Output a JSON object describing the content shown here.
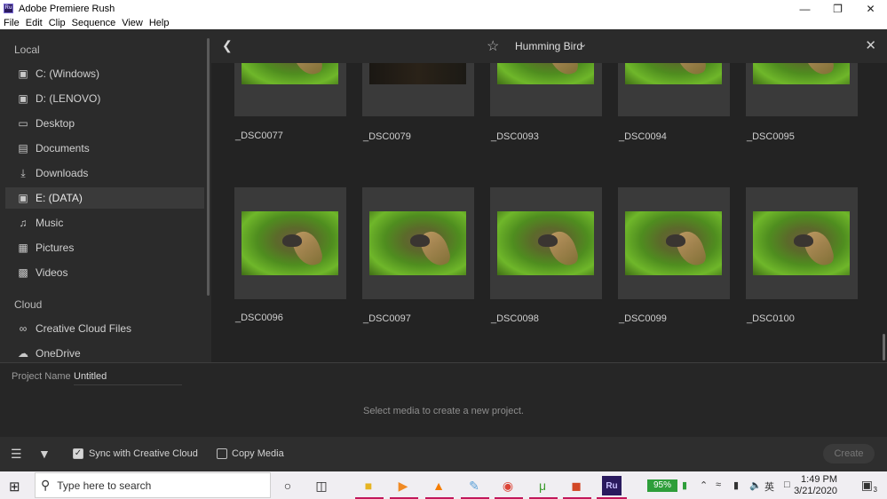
{
  "window": {
    "title": "Adobe Premiere Rush",
    "icon_text": "Ru"
  },
  "menu": [
    "File",
    "Edit",
    "Clip",
    "Sequence",
    "View",
    "Help"
  ],
  "sidebar": {
    "local_heading": "Local",
    "local_items": [
      {
        "label": "C: (Windows)",
        "icon": "monitor-icon"
      },
      {
        "label": "D: (LENOVO)",
        "icon": "monitor-icon"
      },
      {
        "label": "Desktop",
        "icon": "desktop-icon"
      },
      {
        "label": "Documents",
        "icon": "document-icon"
      },
      {
        "label": "Downloads",
        "icon": "download-icon"
      },
      {
        "label": "E: (DATA)",
        "icon": "monitor-icon",
        "selected": true
      },
      {
        "label": "Music",
        "icon": "music-icon"
      },
      {
        "label": "Pictures",
        "icon": "picture-icon"
      },
      {
        "label": "Videos",
        "icon": "video-icon"
      }
    ],
    "cloud_heading": "Cloud",
    "cloud_items": [
      {
        "label": "Creative Cloud Files",
        "icon": "creative-cloud-icon"
      },
      {
        "label": "OneDrive",
        "icon": "onedrive-icon"
      }
    ]
  },
  "browser": {
    "folder": "Humming Bird",
    "row1": [
      "_DSC0077",
      "_DSC0079",
      "_DSC0093",
      "_DSC0094",
      "_DSC0095"
    ],
    "row2": [
      "_DSC0096",
      "_DSC0097",
      "_DSC0098",
      "_DSC0099",
      "_DSC0100"
    ]
  },
  "project": {
    "name_label": "Project Name",
    "name_value": "Untitled",
    "hint": "Select media to create a new project."
  },
  "toolbar": {
    "sync_label": "Sync with Creative Cloud",
    "sync_checked": true,
    "copy_label": "Copy Media",
    "copy_checked": false,
    "create_label": "Create"
  },
  "taskbar": {
    "search_placeholder": "Type here to search",
    "battery": "95%",
    "lang": "英",
    "time": "1:49 PM",
    "date": "3/21/2020",
    "notifications": "3"
  }
}
